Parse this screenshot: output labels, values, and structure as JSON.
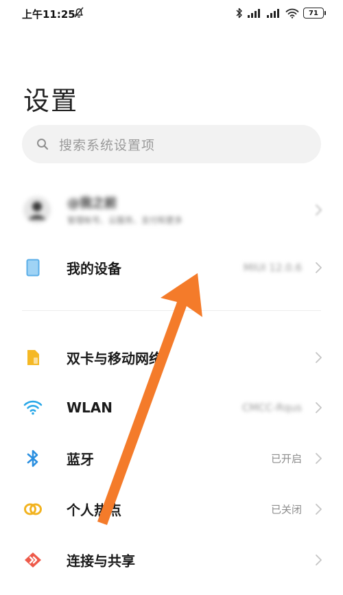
{
  "status_bar": {
    "time": "上午11:25",
    "battery": "71"
  },
  "page": {
    "title": "设置"
  },
  "search": {
    "placeholder": "搜索系统设置项"
  },
  "account": {
    "name": "@我之前",
    "subtitle": "管理帐号、云服务、支付和更多"
  },
  "my_device": {
    "label": "我的设备",
    "value": "MIUI 12.0.6"
  },
  "settings": [
    {
      "label": "双卡与移动网络",
      "value": "",
      "icon": "sim-card-icon",
      "color": "#f5b824"
    },
    {
      "label": "WLAN",
      "value": "CMCC-Rqus",
      "icon": "wifi-icon",
      "color": "#2aa8e8"
    },
    {
      "label": "蓝牙",
      "value": "已开启",
      "icon": "bluetooth-icon",
      "color": "#2a8fe0"
    },
    {
      "label": "个人热点",
      "value": "已关闭",
      "icon": "hotspot-icon",
      "color": "#f2b320"
    },
    {
      "label": "连接与共享",
      "value": "",
      "icon": "connection-share-icon",
      "color": "#ee5a4a"
    }
  ],
  "colors": {
    "device_icon": "#5aaee8",
    "annotation_arrow": "#f47b2a"
  }
}
